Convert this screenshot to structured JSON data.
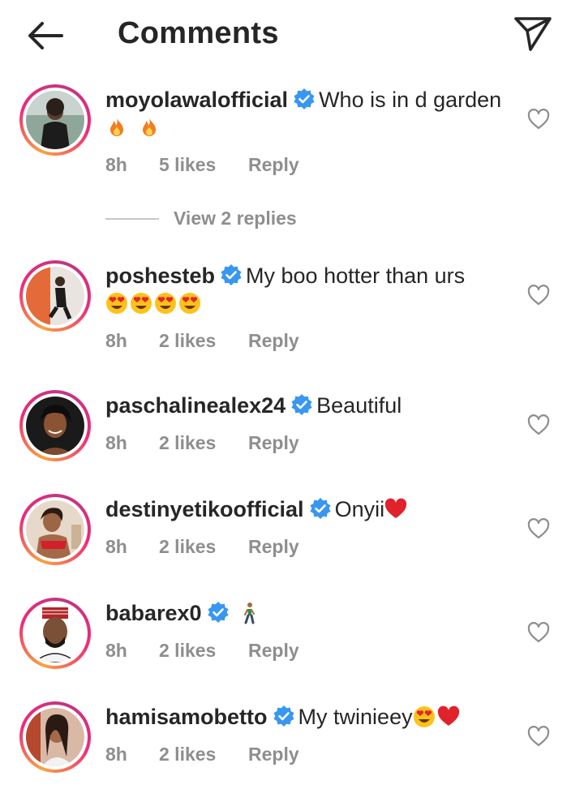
{
  "header": {
    "title": "Comments",
    "back_icon": "arrow-left-icon",
    "share_icon": "paper-plane-icon"
  },
  "view_replies": {
    "label": "View 2 replies"
  },
  "comments": [
    {
      "username": "moyolawalofficial",
      "verified": true,
      "text": "Who is in d garden",
      "emojis": [
        "fire-emoji",
        "fire-emoji"
      ],
      "time": "8h",
      "likes": "5 likes",
      "reply": "Reply"
    },
    {
      "username": "poshesteb",
      "verified": true,
      "text": "My boo hotter than urs",
      "emojis": [
        "heart-eyes-emoji",
        "heart-eyes-emoji",
        "heart-eyes-emoji",
        "heart-eyes-emoji"
      ],
      "time": "8h",
      "likes": "2 likes",
      "reply": "Reply"
    },
    {
      "username": "paschalinealex24",
      "verified": true,
      "text": "Beautiful",
      "emojis": [],
      "time": "8h",
      "likes": "2 likes",
      "reply": "Reply"
    },
    {
      "username": "destinyetikoofficial",
      "verified": true,
      "text": "Onyii",
      "emojis": [
        "red-heart-emoji"
      ],
      "time": "8h",
      "likes": "2 likes",
      "reply": "Reply"
    },
    {
      "username": "babarex0",
      "verified": true,
      "text": "",
      "emojis": [
        "person-walking-emoji"
      ],
      "time": "8h",
      "likes": "2 likes",
      "reply": "Reply"
    },
    {
      "username": "hamisamobetto",
      "verified": true,
      "text": "My twinieey",
      "emojis": [
        "heart-eyes-emoji",
        "red-heart-emoji"
      ],
      "time": "8h",
      "likes": "2 likes",
      "reply": "Reply"
    }
  ],
  "colors": {
    "text": "#262626",
    "secondary": "#8e8e8e",
    "verified_blue": "#3897f0",
    "story_ring_start": "#f9a33f",
    "story_ring_end": "#c13584"
  }
}
